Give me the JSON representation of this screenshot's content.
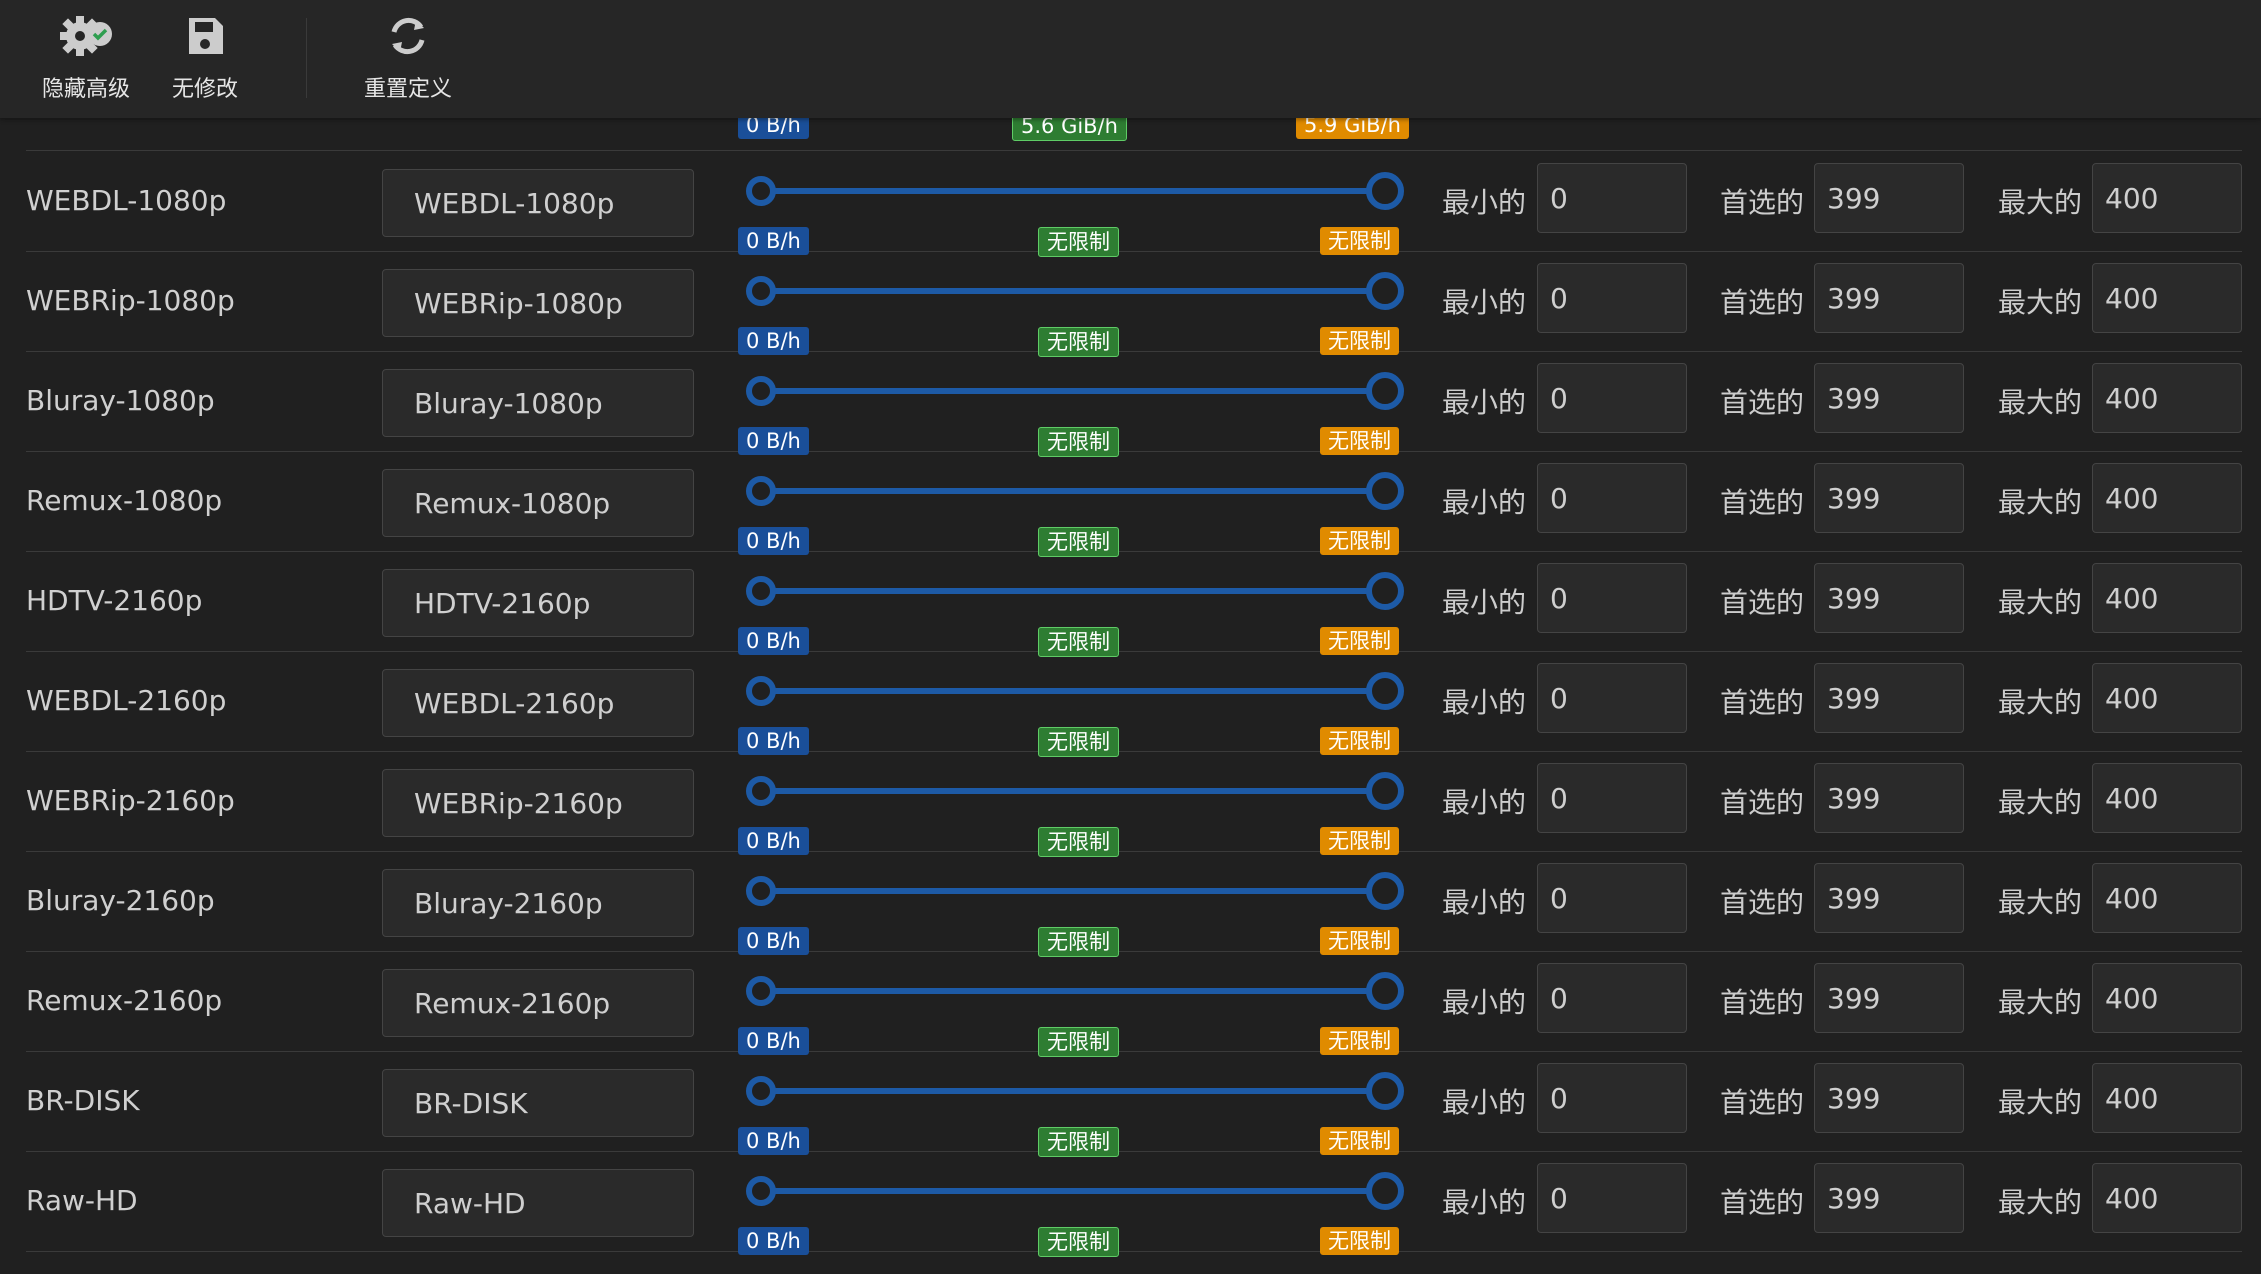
{
  "toolbar": {
    "buttons": [
      {
        "label": "隐藏高级",
        "icon": "gear-check-icon"
      },
      {
        "label": "无修改",
        "icon": "save-icon"
      },
      {
        "label": "重置定义",
        "icon": "refresh-icon"
      }
    ]
  },
  "colors": {
    "track": "#1d5aa6",
    "min_badge": "#1a4f99",
    "preferred_badge": "#2e7d32",
    "max_badge": "#e08b00"
  },
  "partial_row": {
    "min_badge": "0 B/h",
    "preferred_badge": "5.6 GiB/h",
    "max_badge": "5.9 GiB/h"
  },
  "field_labels": {
    "min": "最小的",
    "preferred": "首选的",
    "max": "最大的"
  },
  "rows": [
    {
      "name": "WEBDL-1080p",
      "title": "WEBDL-1080p",
      "min_badge": "0 B/h",
      "preferred_badge": "无限制",
      "max_badge": "无限制",
      "min": "0",
      "preferred": "399",
      "max": "400"
    },
    {
      "name": "WEBRip-1080p",
      "title": "WEBRip-1080p",
      "min_badge": "0 B/h",
      "preferred_badge": "无限制",
      "max_badge": "无限制",
      "min": "0",
      "preferred": "399",
      "max": "400"
    },
    {
      "name": "Bluray-1080p",
      "title": "Bluray-1080p",
      "min_badge": "0 B/h",
      "preferred_badge": "无限制",
      "max_badge": "无限制",
      "min": "0",
      "preferred": "399",
      "max": "400"
    },
    {
      "name": "Remux-1080p",
      "title": "Remux-1080p",
      "min_badge": "0 B/h",
      "preferred_badge": "无限制",
      "max_badge": "无限制",
      "min": "0",
      "preferred": "399",
      "max": "400"
    },
    {
      "name": "HDTV-2160p",
      "title": "HDTV-2160p",
      "min_badge": "0 B/h",
      "preferred_badge": "无限制",
      "max_badge": "无限制",
      "min": "0",
      "preferred": "399",
      "max": "400"
    },
    {
      "name": "WEBDL-2160p",
      "title": "WEBDL-2160p",
      "min_badge": "0 B/h",
      "preferred_badge": "无限制",
      "max_badge": "无限制",
      "min": "0",
      "preferred": "399",
      "max": "400"
    },
    {
      "name": "WEBRip-2160p",
      "title": "WEBRip-2160p",
      "min_badge": "0 B/h",
      "preferred_badge": "无限制",
      "max_badge": "无限制",
      "min": "0",
      "preferred": "399",
      "max": "400"
    },
    {
      "name": "Bluray-2160p",
      "title": "Bluray-2160p",
      "min_badge": "0 B/h",
      "preferred_badge": "无限制",
      "max_badge": "无限制",
      "min": "0",
      "preferred": "399",
      "max": "400"
    },
    {
      "name": "Remux-2160p",
      "title": "Remux-2160p",
      "min_badge": "0 B/h",
      "preferred_badge": "无限制",
      "max_badge": "无限制",
      "min": "0",
      "preferred": "399",
      "max": "400"
    },
    {
      "name": "BR-DISK",
      "title": "BR-DISK",
      "min_badge": "0 B/h",
      "preferred_badge": "无限制",
      "max_badge": "无限制",
      "min": "0",
      "preferred": "399",
      "max": "400"
    },
    {
      "name": "Raw-HD",
      "title": "Raw-HD",
      "min_badge": "0 B/h",
      "preferred_badge": "无限制",
      "max_badge": "无限制",
      "min": "0",
      "preferred": "399",
      "max": "400"
    }
  ]
}
